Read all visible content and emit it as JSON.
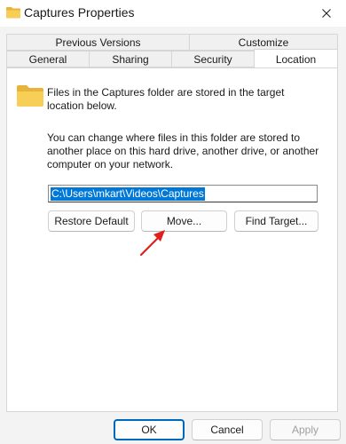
{
  "window": {
    "title": "Captures Properties",
    "close_icon": "close-icon",
    "folder_icon": "folder-icon"
  },
  "tabs": {
    "back_row": [
      "Previous Versions",
      "Customize"
    ],
    "front_row": [
      "General",
      "Sharing",
      "Security",
      "Location"
    ],
    "active": "Location"
  },
  "location": {
    "info_text": "Files in the Captures folder are stored in the target location below.",
    "change_text": "You can change where files in this folder are stored to another place on this hard drive, another drive, or another computer on your network.",
    "path_value": "C:\\Users\\mkart\\Videos\\Captures",
    "restore_label": "Restore Default",
    "move_label": "Move...",
    "find_label": "Find Target..."
  },
  "footer": {
    "ok_label": "OK",
    "cancel_label": "Cancel",
    "apply_label": "Apply"
  },
  "colors": {
    "accent": "#0067c0",
    "selection": "#0078d7",
    "annotation_arrow": "#e0201e",
    "folder": "#f2c94c"
  }
}
